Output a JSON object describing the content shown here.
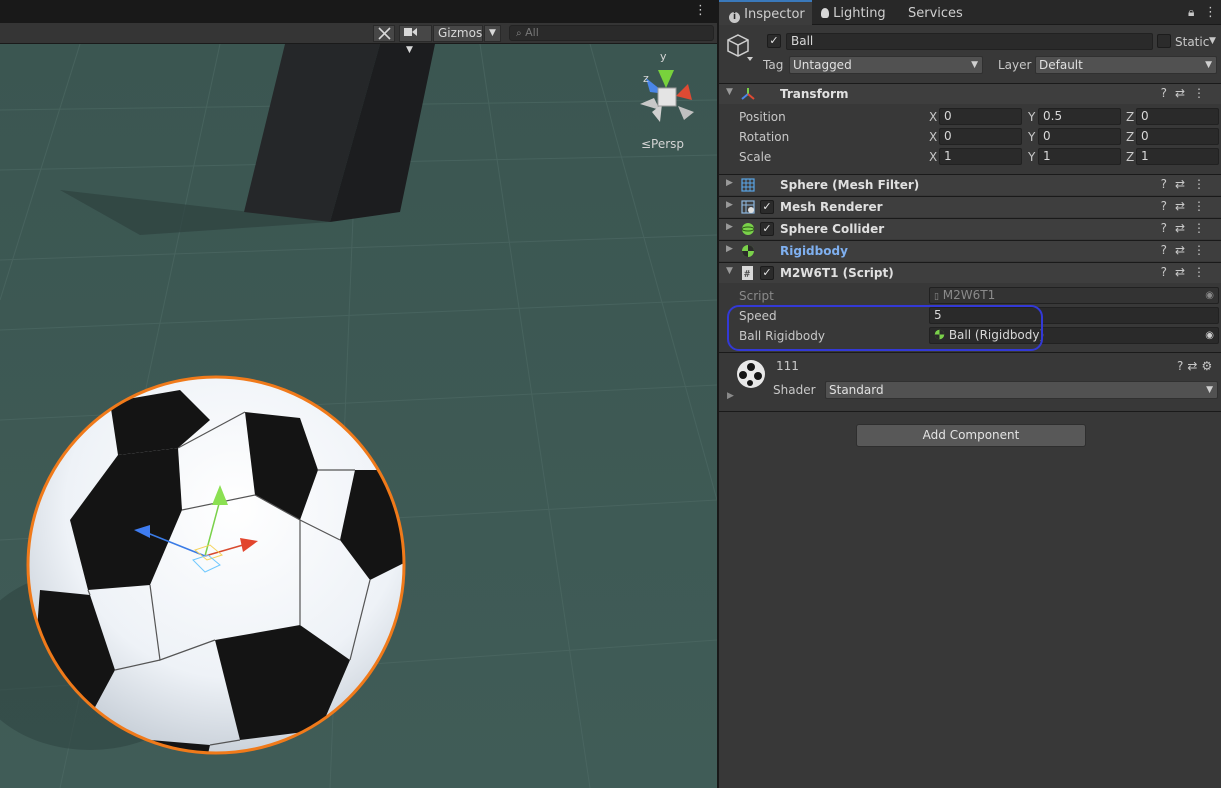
{
  "scene": {
    "toolbar": {
      "gizmos_label": "Gizmos",
      "search_placeholder": "All",
      "more_menu": "⋮"
    },
    "orientation_gizmo": {
      "axis_y": "y",
      "axis_z": "z",
      "projection_label": "≤Persp"
    }
  },
  "inspector": {
    "tabs": [
      {
        "label": "Inspector",
        "icon": "info-icon",
        "active": true
      },
      {
        "label": "Lighting",
        "icon": "bulb-icon",
        "active": false
      },
      {
        "label": "Services",
        "icon": "",
        "active": false
      }
    ],
    "object": {
      "name": "Ball",
      "enabled": true,
      "static_label": "Static",
      "tag_label": "Tag",
      "tag_value": "Untagged",
      "layer_label": "Layer",
      "layer_value": "Default"
    },
    "transform": {
      "title": "Transform",
      "rows": [
        {
          "label": "Position",
          "x": "0",
          "y": "0.5",
          "z": "0"
        },
        {
          "label": "Rotation",
          "x": "0",
          "y": "0",
          "z": "0"
        },
        {
          "label": "Scale",
          "x": "1",
          "y": "1",
          "z": "1"
        }
      ],
      "axis_x": "X",
      "axis_y": "Y",
      "axis_z": "Z"
    },
    "components": [
      {
        "title": "Sphere (Mesh Filter)",
        "icon": "grid-icon",
        "has_checkbox": false
      },
      {
        "title": "Mesh Renderer",
        "icon": "mesh-renderer-icon",
        "has_checkbox": true
      },
      {
        "title": "Sphere Collider",
        "icon": "sphere-collider-icon",
        "has_checkbox": true
      },
      {
        "title": "Rigidbody",
        "icon": "rigidbody-icon",
        "has_checkbox": false
      },
      {
        "title": "M2W6T1 (Script)",
        "icon": "script-icon",
        "has_checkbox": true
      }
    ],
    "script": {
      "script_label": "Script",
      "script_value": "M2W6T1",
      "speed_label": "Speed",
      "speed_value": "5",
      "rb_label": "Ball Rigidbody",
      "rb_value": "Ball (Rigidbody)"
    },
    "material": {
      "name": "111",
      "shader_label": "Shader",
      "shader_value": "Standard"
    },
    "add_component_label": "Add Component"
  },
  "colors": {
    "accent": "#3a79bb",
    "annotation": "#3339d6",
    "selection_outline": "#f07a1a",
    "scene_ground": "#3e5a55"
  }
}
